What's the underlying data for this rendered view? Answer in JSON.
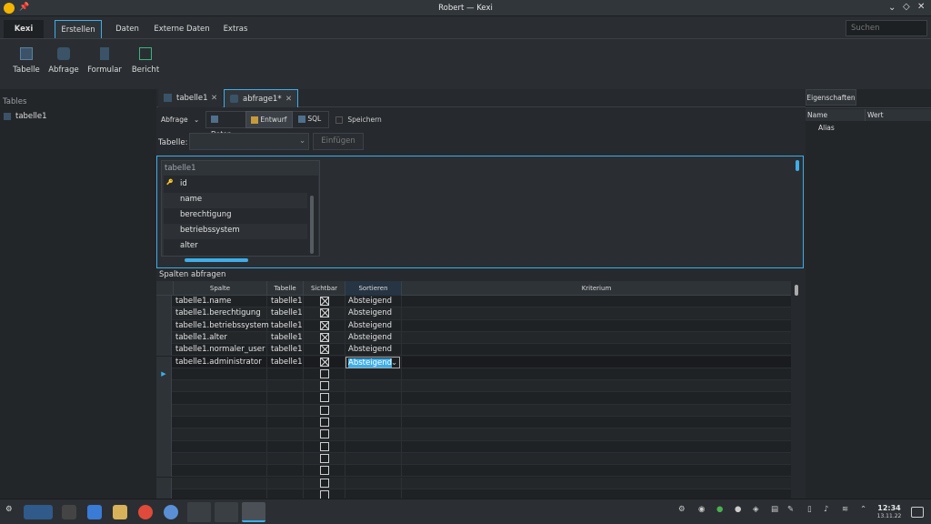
{
  "window": {
    "title": "Robert — Kexi"
  },
  "ribbon": {
    "tabs": [
      "Kexi",
      "Erstellen",
      "Daten",
      "Externe Daten",
      "Extras"
    ],
    "search_placeholder": "Suchen",
    "buttons": [
      "Tabelle",
      "Abfrage",
      "Formular",
      "Bericht"
    ]
  },
  "left_panel": {
    "section": "Tables",
    "items": [
      "tabelle1"
    ]
  },
  "doc_tabs": [
    "tabelle1",
    "abfrage1*"
  ],
  "toolbar": {
    "query_label": "Abfrage",
    "modes": [
      "Daten",
      "Entwurf",
      "SQL"
    ],
    "save_label": "Speichern",
    "table_label": "Tabelle:",
    "insert_label": "Einfügen"
  },
  "table_box": {
    "title": "tabelle1",
    "fields": [
      "id",
      "name",
      "berechtigung",
      "betriebssystem",
      "alter"
    ]
  },
  "grid": {
    "title": "Spalten abfragen",
    "headers": [
      "Spalte",
      "Tabelle",
      "Sichtbar",
      "Sortieren",
      "Kriterium"
    ],
    "rows": [
      {
        "spalte": "tabelle1.name",
        "tabelle": "tabelle1",
        "sort": "Absteigend"
      },
      {
        "spalte": "tabelle1.berechtigung",
        "tabelle": "tabelle1",
        "sort": "Absteigend"
      },
      {
        "spalte": "tabelle1.betriebssystem",
        "tabelle": "tabelle1",
        "sort": "Absteigend"
      },
      {
        "spalte": "tabelle1.alter",
        "tabelle": "tabelle1",
        "sort": "Absteigend"
      },
      {
        "spalte": "tabelle1.normaler_user",
        "tabelle": "tabelle1",
        "sort": "Absteigend"
      },
      {
        "spalte": "tabelle1.administrator",
        "tabelle": "tabelle1",
        "sort": "Absteigend"
      }
    ]
  },
  "properties": {
    "title": "Eigenschaften",
    "col_name": "Name",
    "col_value": "Wert",
    "items": [
      "Alias"
    ]
  },
  "clock": {
    "time": "12:34",
    "date": "13.11.22"
  },
  "colors": {
    "accent": "#3daee9",
    "bg": "#232629",
    "panel": "#2a2e32"
  }
}
